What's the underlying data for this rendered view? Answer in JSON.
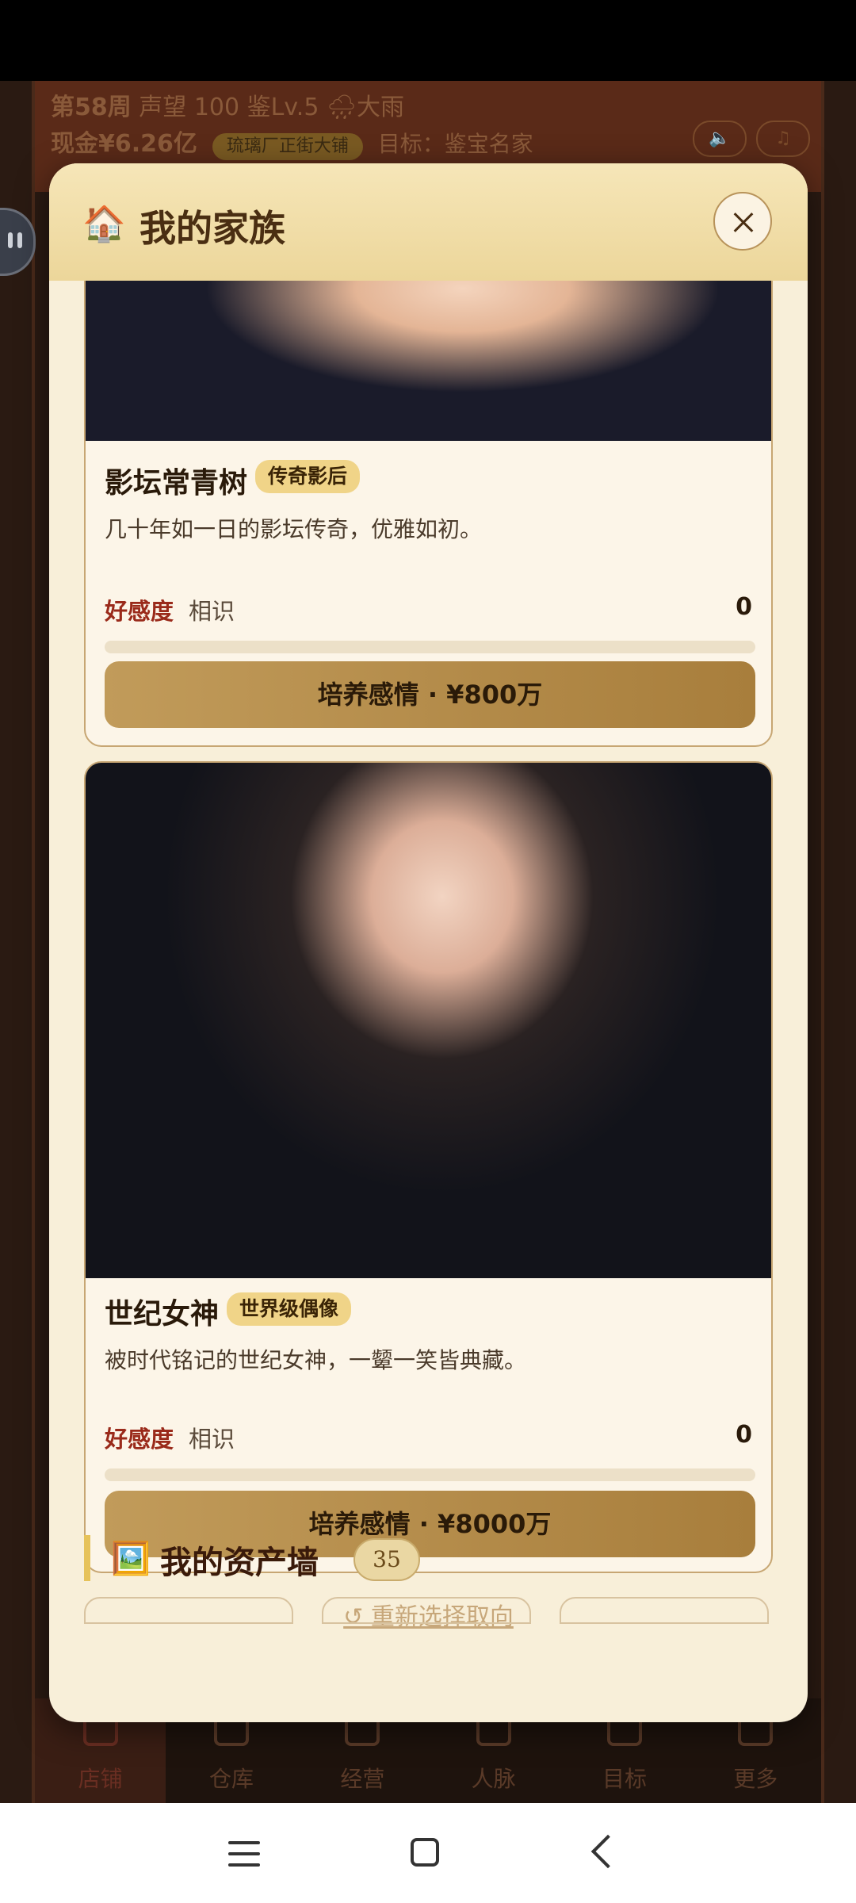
{
  "hud": {
    "week": "第58周",
    "reputation": "声望 100",
    "appraisal": "鉴Lv.5",
    "weather": "🌧大雨",
    "cash": "现金¥6.26亿",
    "shop_tag": "琉璃厂正街大铺",
    "goal": "目标：鉴宝名家",
    "sound_icon": "speaker-icon",
    "music_icon": "music-icon"
  },
  "modal": {
    "icon": "🏠",
    "title": "我的家族",
    "close_icon": "close-icon"
  },
  "characters": [
    {
      "name": "影坛常青树",
      "badge": "传奇影后",
      "description": "几十年如一日的影坛传奇，优雅如初。",
      "favor_label": "好感度",
      "favor_level": "相识",
      "favor_value": "0",
      "favor_progress": 0,
      "action_label": "培养感情 · ¥800万"
    },
    {
      "name": "世纪女神",
      "badge": "世界级偶像",
      "description": "被时代铭记的世纪女神，一颦一笑皆典藏。",
      "favor_label": "好感度",
      "favor_level": "相识",
      "favor_value": "0",
      "favor_progress": 0,
      "action_label": "培养感情 · ¥8000万"
    }
  ],
  "reset_link": "↺ 重新选择取向",
  "asset_wall": {
    "icon": "🖼️",
    "title": "我的资产墙",
    "count": "35"
  },
  "bottom_nav": [
    {
      "label": "店铺",
      "active": true
    },
    {
      "label": "仓库",
      "active": false
    },
    {
      "label": "经营",
      "active": false
    },
    {
      "label": "人脉",
      "active": false
    },
    {
      "label": "目标",
      "active": false
    },
    {
      "label": "更多",
      "active": false
    }
  ],
  "colors": {
    "accent_gold": "#c19b5a",
    "favor_red": "#9a2a1a",
    "modal_bg": "#f8efd9"
  }
}
